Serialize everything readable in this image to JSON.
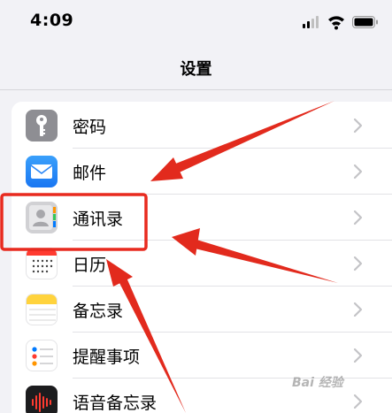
{
  "status_bar": {
    "time": "4:09"
  },
  "nav": {
    "title": "设置"
  },
  "settings": {
    "items": [
      {
        "label": "密码",
        "icon": "key-icon",
        "color": "#8e8e93"
      },
      {
        "label": "邮件",
        "icon": "mail-icon",
        "color": "#1f8efa"
      },
      {
        "label": "通讯录",
        "icon": "contacts-icon",
        "color": "#c6c6c9"
      },
      {
        "label": "日历",
        "icon": "calendar-icon",
        "color": "#ffffff"
      },
      {
        "label": "备忘录",
        "icon": "notes-icon",
        "color": "#ffd33d"
      },
      {
        "label": "提醒事项",
        "icon": "reminders-icon",
        "color": "#ffffff"
      },
      {
        "label": "语音备忘录",
        "icon": "voice-memos-icon",
        "color": "#1c1c1e"
      }
    ]
  },
  "annotations": {
    "highlight_color": "#e82a1f",
    "arrow_color": "#e22a1d"
  },
  "watermark": {
    "text": "Bai 经验"
  }
}
